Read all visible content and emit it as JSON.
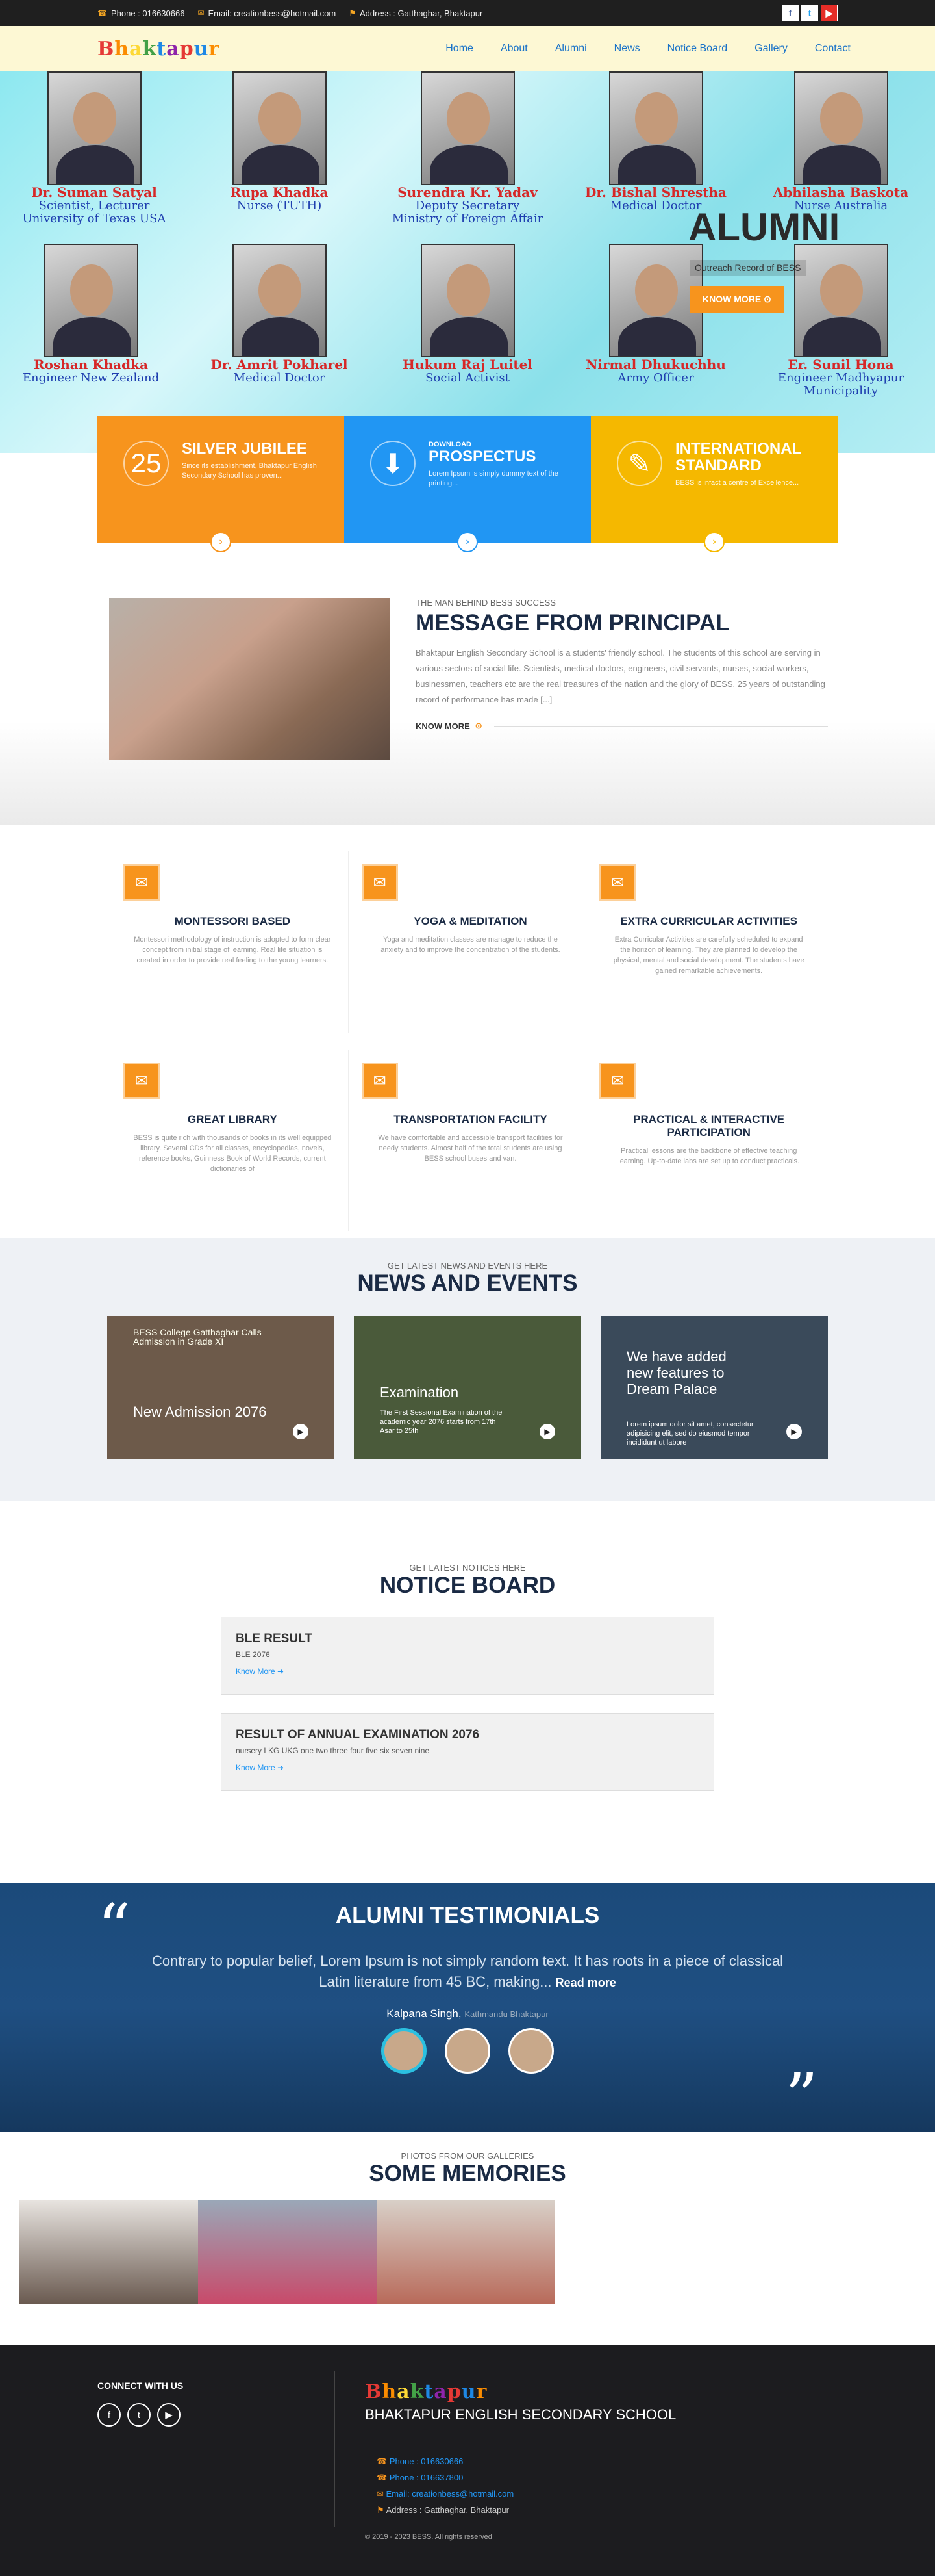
{
  "topbar": {
    "phone": "Phone : 016630666",
    "email": "Email: creationbess@hotmail.com",
    "address": "Address : Gatthaghar, Bhaktapur"
  },
  "nav": {
    "logo": [
      "B",
      "h",
      "a",
      "k",
      "t",
      "a",
      "p",
      "u",
      "r"
    ],
    "items": [
      "Home",
      "About",
      "Alumni",
      "News",
      "Notice Board",
      "Gallery",
      "Contact"
    ]
  },
  "hero": {
    "people": [
      {
        "name": "Dr. Suman Satyal",
        "role": "Scientist, Lecturer University of Texas USA"
      },
      {
        "name": "Rupa Khadka",
        "role": "Nurse (TUTH)"
      },
      {
        "name": "Surendra Kr. Yadav",
        "role": "Deputy Secretary Ministry of Foreign Affair"
      },
      {
        "name": "Dr. Bishal Shrestha",
        "role": "Medical Doctor"
      },
      {
        "name": "Abhilasha Baskota",
        "role": "Nurse Australia"
      },
      {
        "name": "Roshan Khadka",
        "role": "Engineer New Zealand"
      },
      {
        "name": "Dr. Amrit Pokharel",
        "role": "Medical Doctor"
      },
      {
        "name": "Hukum Raj Luitel",
        "role": "Social Activist"
      },
      {
        "name": "Nirmal Dhukuchhu",
        "role": "Army Officer"
      },
      {
        "name": "Er. Sunil Hona",
        "role": "Engineer Madhyapur Municipality"
      }
    ],
    "title": "ALUMNI",
    "subtitle": "Outreach Record of BESS",
    "button": "KNOW MORE"
  },
  "features": [
    {
      "title": "SILVER JUBILEE",
      "text": "Since its establishment, Bhaktapur English Secondary School has proven...",
      "icon": "25-badge-icon"
    },
    {
      "small": "DOWNLOAD",
      "title": "PROSPECTUS",
      "text": "Lorem Ipsum is simply dummy text of the printing...",
      "icon": "download-icon"
    },
    {
      "title": "INTERNATIONAL STANDARD",
      "text": "BESS is infact a centre of Excellence...",
      "icon": "certificate-icon"
    }
  ],
  "principal": {
    "small": "THE MAN BEHIND BESS SUCCESS",
    "title": "MESSAGE FROM PRINCIPAL",
    "text": "Bhaktapur English Secondary School is a students' friendly school. The students of this school are serving in various sectors of social life. Scientists, medical doctors, engineers, civil servants, nurses, social workers, businessmen, teachers etc are the real treasures of the nation and the glory of BESS. 25 years of outstanding record of performance has made [...]",
    "button": "KNOW MORE"
  },
  "services": [
    {
      "title": "MONTESSORI BASED",
      "text": "Montessori methodology of instruction is adopted to form clear concept from initial stage of learning. Real life situation is created in order to provide real feeling to the young learners."
    },
    {
      "title": "YOGA & MEDITATION",
      "text": "Yoga and meditation classes are manage to reduce the anxiety and to improve the concentration of the students."
    },
    {
      "title": "EXTRA CURRICULAR ACTIVITIES",
      "text": "Extra Curricular Activities are carefully scheduled to expand the horizon of learning. They are planned to develop the physical, mental and social development. The students have gained remarkable achievements."
    },
    {
      "title": "GREAT LIBRARY",
      "text": "BESS is quite rich with thousands of books in its well equipped library. Several CDs for all classes, encyclopedias, novels, reference books, Guinness Book of World Records, current dictionaries of"
    },
    {
      "title": "TRANSPORTATION FACILITY",
      "text": "We have comfortable and accessible transport facilities for needy students. Almost half of the total students are using BESS school buses and van."
    },
    {
      "title": "PRACTICAL & INTERACTIVE PARTICIPATION",
      "text": "Practical lessons are the backbone of effective teaching learning. Up-to-date labs are set up to conduct practicals."
    }
  ],
  "news": {
    "small": "GET LATEST NEWS AND EVENTS HERE",
    "title": "NEWS AND EVENTS",
    "items": [
      {
        "title": "New Admission 2076",
        "text": "BESS College Gatthaghar Calls Admission in Grade XI"
      },
      {
        "title": "Examination",
        "text": "The First Sessional Examination of the academic year 2076 starts from 17th Asar to 25th"
      },
      {
        "title": "We have added new features to Dream Palace",
        "text": "Lorem ipsum dolor sit amet, consectetur adipisicing elit, sed do eiusmod tempor incididunt ut labore"
      }
    ]
  },
  "notice": {
    "small": "GET LATEST NOTICES HERE",
    "title": "NOTICE BOARD",
    "items": [
      {
        "title": "BLE RESULT",
        "text": "BLE 2076",
        "link": "Know More"
      },
      {
        "title": "RESULT OF ANNUAL EXAMINATION 2076",
        "text": "nursery LKG UKG one two three four five six seven nine",
        "link": "Know More"
      }
    ]
  },
  "testimonials": {
    "title": "ALUMNI TESTIMONIALS",
    "quote": "Contrary to popular belief, Lorem Ipsum is not simply random text. It has roots in a piece of classical Latin literature from 45 BC, making...",
    "more": "Read more",
    "name": "Kalpana Singh,",
    "place": "Kathmandu Bhaktapur"
  },
  "memories": {
    "small": "PHOTOS FROM OUR GALLERIES",
    "title": "SOME MEMORIES"
  },
  "footer": {
    "connect": "CONNECT WITH US",
    "school": "BHAKTAPUR ENGLISH SECONDARY SCHOOL",
    "phone1": "Phone : 016630666",
    "phone2": "Phone : 016637800",
    "email": "Email: creationbess@hotmail.com",
    "address": "Address : Gatthaghar, Bhaktapur",
    "copyright": "© 2019 - 2023 BESS. All rights reserved"
  },
  "colors": {
    "orange": "#f7941d",
    "blue": "#2196f3",
    "yellow": "#f5b800",
    "navy": "#1a2a44"
  }
}
